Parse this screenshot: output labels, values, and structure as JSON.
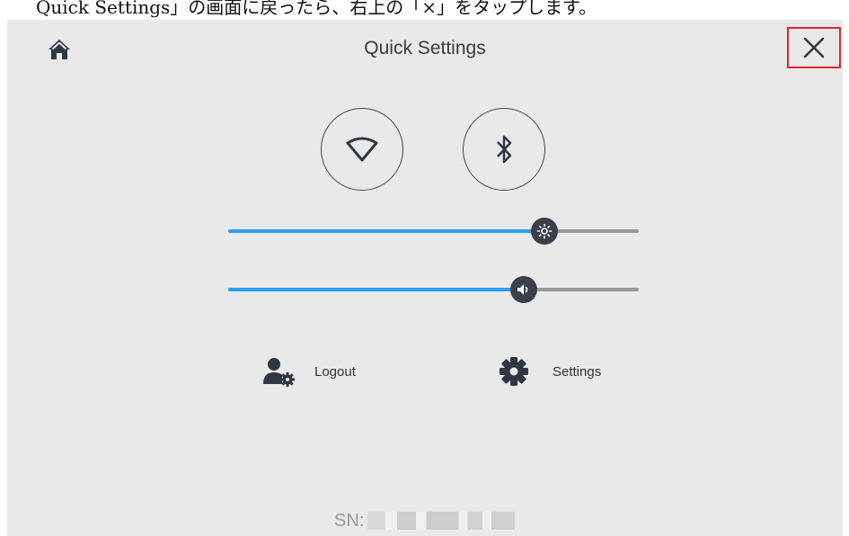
{
  "caption": "Quick Settings」の画面に戻ったら、右上の「×」をタップします。",
  "header": {
    "title": "Quick Settings",
    "home_icon": "home-icon",
    "close_icon": "close-icon"
  },
  "toggles": {
    "wifi_icon": "wifi-icon",
    "bluetooth_icon": "bluetooth-icon"
  },
  "sliders": {
    "brightness": {
      "icon": "brightness-icon",
      "level": 0.77,
      "fill_color": "#2e9df3"
    },
    "volume": {
      "icon": "volume-icon",
      "level": 0.72,
      "fill_color": "#2e9df3"
    }
  },
  "actions": {
    "logout_label": "Logout",
    "logout_icon": "user-gear-icon",
    "settings_label": "Settings",
    "settings_icon": "gear-icon"
  },
  "footer": {
    "sn_label": "SN:"
  },
  "colors": {
    "highlight_border": "#e0262b",
    "panel_bg": "#e9e9e9",
    "accent": "#2e9df3"
  }
}
